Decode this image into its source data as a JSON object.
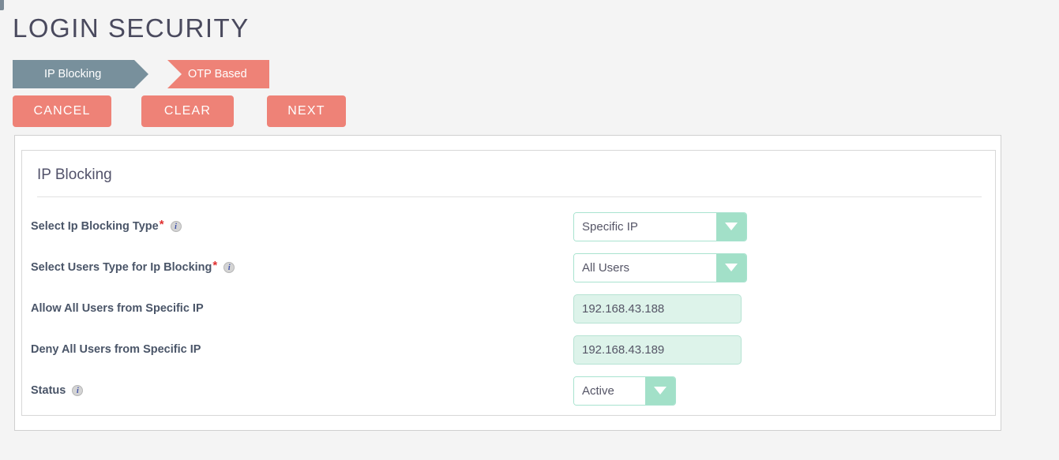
{
  "page": {
    "title": "LOGIN SECURITY"
  },
  "steps": [
    {
      "label": "IP Blocking",
      "state": "completed",
      "color": "#78909c"
    },
    {
      "label": "OTP Based",
      "state": "active",
      "color": "#ee8277"
    }
  ],
  "actions": {
    "cancel_label": "CANCEL",
    "clear_label": "CLEAR",
    "next_label": "NEXT",
    "button_color": "#ee8277"
  },
  "card": {
    "title": "IP Blocking",
    "fields": [
      {
        "label": "Select Ip Blocking Type",
        "required": "*",
        "info": "i",
        "control": "select",
        "value": "Specific IP"
      },
      {
        "label": "Select Users Type for Ip Blocking",
        "required": "*",
        "info": "i",
        "control": "select",
        "value": "All Users"
      },
      {
        "label": "Allow All Users from Specific IP",
        "control": "text",
        "value": "192.168.43.188",
        "placeholder": ""
      },
      {
        "label": "Deny All Users from Specific IP",
        "control": "text",
        "value": "192.168.43.189",
        "placeholder": ""
      },
      {
        "label": "Status",
        "info": "i",
        "control": "select",
        "value": "Active"
      }
    ]
  },
  "theme": {
    "accent": "#ee8277",
    "mint": "#a2e0c8",
    "mint_fill": "#ddf3ea",
    "step_gray": "#78909c",
    "text_dark": "#4a5568"
  }
}
